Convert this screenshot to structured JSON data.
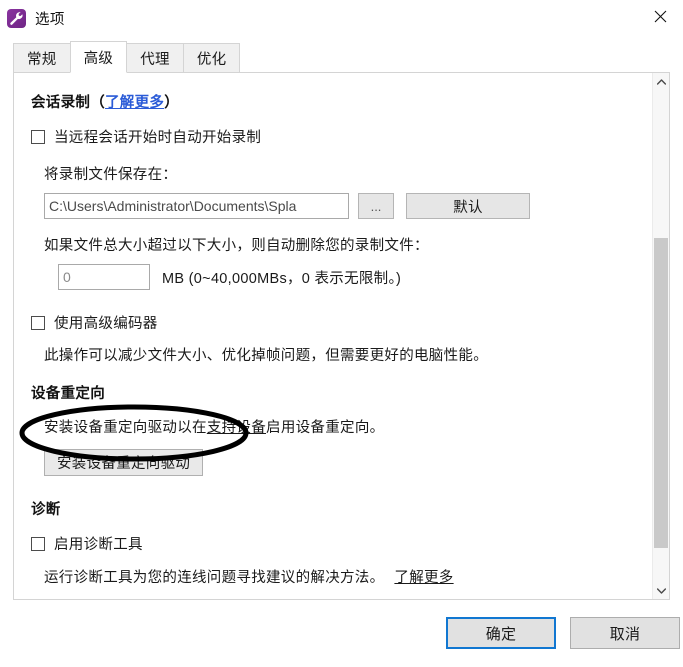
{
  "window": {
    "title": "选项",
    "icon": "wrench-icon",
    "close_label": "×"
  },
  "tabs": [
    {
      "label": "常规",
      "active": false
    },
    {
      "label": "高级",
      "active": true
    },
    {
      "label": "代理",
      "active": false
    },
    {
      "label": "优化",
      "active": false
    }
  ],
  "session_recording": {
    "heading": "会话录制（",
    "heading_link": "了解更多",
    "heading_suffix": "）",
    "auto_record_checkbox": {
      "label": "当远程会话开始时自动开始录制",
      "checked": false
    },
    "save_path_label": "将录制文件保存在：",
    "path_value": "C:\\Users\\Administrator\\Documents\\Spla",
    "browse_label": "...",
    "default_label": "默认",
    "size_limit_label": "如果文件总大小超过以下大小，则自动删除您的录制文件：",
    "size_value": "0",
    "size_unit_note": "MB (0~40,000MBs，0 表示无限制。)"
  },
  "advanced_encoder": {
    "checkbox": {
      "label": "使用高级编码器",
      "checked": false
    },
    "description": "此操作可以减少文件大小、优化掉帧问题，但需要更好的电脑性能。"
  },
  "device_redirection": {
    "heading": "设备重定向",
    "desc_prefix": "安装设备重定向驱动以在 ",
    "desc_link": "支持设备",
    "desc_suffix": " 启用设备重定向。",
    "install_button_label": "安装设备重定向驱动"
  },
  "diagnostics": {
    "heading": "诊断",
    "checkbox": {
      "label": "启用诊断工具",
      "checked": false
    },
    "description": "运行诊断工具为您的连线问题寻找建议的解决方法。",
    "description_link": "了解更多"
  },
  "scrollbar": {
    "up_arrow": "⌃",
    "down_arrow": "⌄"
  },
  "footer": {
    "ok_label": "确定",
    "cancel_label": "取消"
  },
  "annotation": {
    "shape": "ellipse-highlight",
    "target": "安装设备重定向驱动",
    "color": "#000000"
  },
  "colors": {
    "link": "#2a5bd7",
    "accent_focus": "#1177d1",
    "icon_bg": "#7b2d8e",
    "panel_border": "#d4d4d4"
  }
}
